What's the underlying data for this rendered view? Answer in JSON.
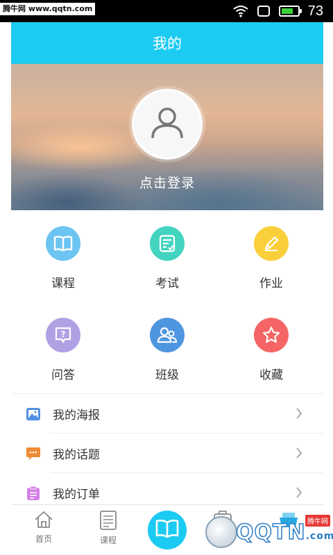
{
  "watermark": {
    "top_left": "腾牛网 www.qqtn.com",
    "bottom_brand": "QQTN",
    "bottom_suffix": ".com",
    "bottom_tag": "腾牛网"
  },
  "status_bar": {
    "battery_level": 73,
    "battery_text": "73",
    "battery_color": "#3ad13a",
    "icons": [
      "wifi-icon",
      "square-icon",
      "battery-icon"
    ]
  },
  "header": {
    "title": "我的",
    "color": "#1ccbf1"
  },
  "profile": {
    "login_text": "点击登录",
    "avatar_icon": "user-icon"
  },
  "grid": [
    {
      "label": "课程",
      "icon": "book-icon",
      "color": "#6cc4f2"
    },
    {
      "label": "考试",
      "icon": "list-check-icon",
      "color": "#43d4c0"
    },
    {
      "label": "作业",
      "icon": "pencil-icon",
      "color": "#f9cf3c"
    },
    {
      "label": "问答",
      "icon": "question-icon",
      "color": "#b1a0e4"
    },
    {
      "label": "班级",
      "icon": "users-icon",
      "color": "#4f96e0"
    },
    {
      "label": "收藏",
      "icon": "star-icon",
      "color": "#f56565"
    }
  ],
  "list": [
    {
      "label": "我的海报",
      "icon": "image-icon",
      "color": "#4f8fe3"
    },
    {
      "label": "我的话题",
      "icon": "chat-icon",
      "color": "#f08a35"
    },
    {
      "label": "我的订单",
      "icon": "clipboard-icon",
      "color": "#d27ee8"
    }
  ],
  "tabbar": [
    {
      "label": "首页",
      "icon": "home-icon"
    },
    {
      "label": "课程",
      "icon": "list-doc-icon"
    },
    {
      "label": "",
      "icon": "book-open-icon"
    },
    {
      "label": "",
      "icon": "camera-icon"
    },
    {
      "label": "",
      "icon": "stack-icon"
    }
  ]
}
